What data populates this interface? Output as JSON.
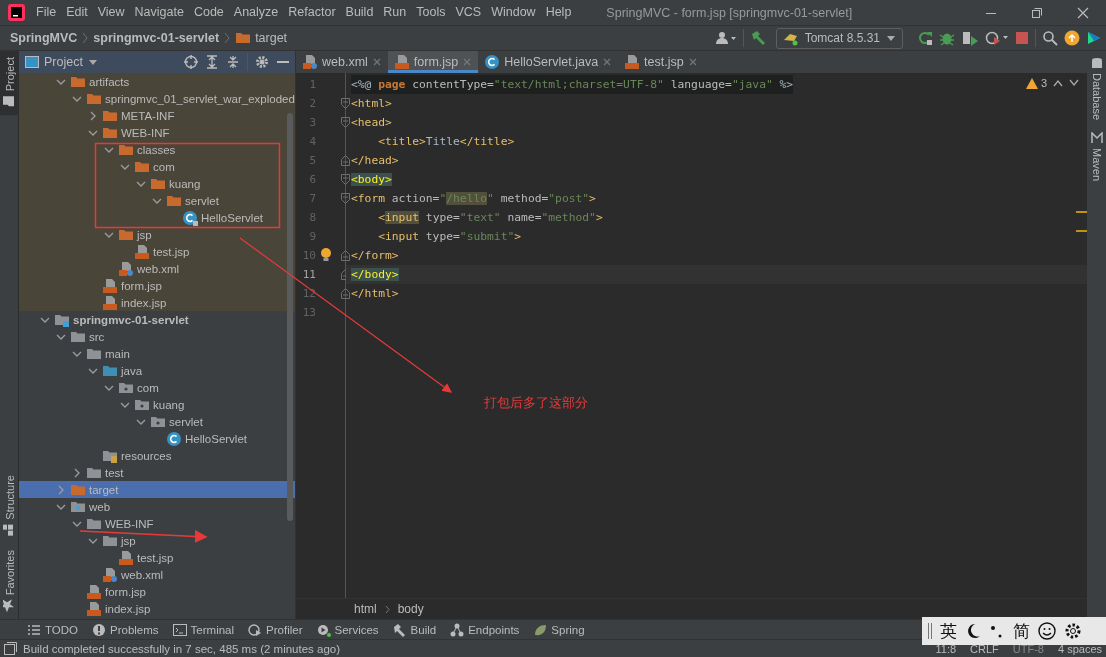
{
  "window": {
    "title": "SpringMVC - form.jsp [springmvc-01-servlet]"
  },
  "menu": [
    "File",
    "Edit",
    "View",
    "Navigate",
    "Code",
    "Analyze",
    "Refactor",
    "Build",
    "Run",
    "Tools",
    "VCS",
    "Window",
    "Help"
  ],
  "breadcrumbs": [
    {
      "label": "SpringMVC",
      "kind": "project"
    },
    {
      "label": "springmvc-01-servlet",
      "kind": "module"
    },
    {
      "label": "target",
      "kind": "folder"
    }
  ],
  "run_config": {
    "label": "Tomcat 8.5.31"
  },
  "left_stripe": [
    {
      "label": "Project",
      "selected": true
    },
    {
      "label": "Structure",
      "selected": false
    },
    {
      "label": "Favorites",
      "selected": false
    }
  ],
  "right_stripe": [
    "Database",
    "Maven"
  ],
  "project_panel": {
    "title": "Project",
    "output_tree": [
      {
        "label": "artifacts",
        "kind": "excluded-folder",
        "expanded": true,
        "selected": false,
        "children": [
          {
            "label": "springmvc_01_servlet_war_exploded",
            "kind": "excluded-folder",
            "expanded": true,
            "selected": false,
            "children": [
              {
                "label": "META-INF",
                "kind": "excluded-folder",
                "expanded": false,
                "selected": false
              },
              {
                "label": "WEB-INF",
                "kind": "excluded-folder",
                "expanded": true,
                "selected": false,
                "children": [
                  {
                    "label": "classes",
                    "kind": "excluded-folder",
                    "expanded": true,
                    "selected": false,
                    "children": [
                      {
                        "label": "com",
                        "kind": "excluded-folder",
                        "expanded": true,
                        "selected": false,
                        "children": [
                          {
                            "label": "kuang",
                            "kind": "excluded-folder",
                            "expanded": true,
                            "selected": false,
                            "children": [
                              {
                                "label": "servlet",
                                "kind": "excluded-folder",
                                "expanded": true,
                                "selected": false,
                                "children": [
                                  {
                                    "label": "HelloServlet",
                                    "kind": "compiled-class",
                                    "selected": false
                                  }
                                ]
                              }
                            ]
                          }
                        ]
                      }
                    ]
                  },
                  {
                    "label": "jsp",
                    "kind": "excluded-folder",
                    "expanded": true,
                    "selected": false,
                    "children": [
                      {
                        "label": "test.jsp",
                        "kind": "jsp",
                        "selected": false
                      }
                    ]
                  },
                  {
                    "label": "web.xml",
                    "kind": "xml",
                    "selected": false
                  }
                ]
              },
              {
                "label": "form.jsp",
                "kind": "jsp",
                "selected": false
              },
              {
                "label": "index.jsp",
                "kind": "jsp",
                "selected": false
              }
            ]
          }
        ]
      }
    ],
    "tree": [
      {
        "label": "springmvc-01-servlet",
        "kind": "module",
        "expanded": true,
        "selected": false,
        "children": [
          {
            "label": "src",
            "kind": "folder",
            "expanded": true,
            "selected": false,
            "children": [
              {
                "label": "main",
                "kind": "folder",
                "expanded": true,
                "selected": false,
                "children": [
                  {
                    "label": "java",
                    "kind": "source-folder",
                    "expanded": true,
                    "selected": false,
                    "children": [
                      {
                        "label": "com",
                        "kind": "package",
                        "expanded": true,
                        "selected": false,
                        "children": [
                          {
                            "label": "kuang",
                            "kind": "package",
                            "expanded": true,
                            "selected": false,
                            "children": [
                              {
                                "label": "servlet",
                                "kind": "package",
                                "expanded": true,
                                "selected": false,
                                "children": [
                                  {
                                    "label": "HelloServlet",
                                    "kind": "class",
                                    "selected": false
                                  }
                                ]
                              }
                            ]
                          }
                        ]
                      }
                    ]
                  },
                  {
                    "label": "resources",
                    "kind": "resources-folder",
                    "selected": false
                  }
                ]
              },
              {
                "label": "test",
                "kind": "folder",
                "expanded": false,
                "selected": false
              }
            ]
          },
          {
            "label": "target",
            "kind": "excluded-folder",
            "expanded": false,
            "selected": true
          },
          {
            "label": "web",
            "kind": "web-folder",
            "expanded": true,
            "selected": false,
            "children": [
              {
                "label": "WEB-INF",
                "kind": "folder",
                "expanded": true,
                "selected": false,
                "children": [
                  {
                    "label": "jsp",
                    "kind": "folder",
                    "expanded": true,
                    "selected": false,
                    "children": [
                      {
                        "label": "test.jsp",
                        "kind": "jsp",
                        "selected": false
                      }
                    ]
                  },
                  {
                    "label": "web.xml",
                    "kind": "xml",
                    "selected": false
                  }
                ]
              },
              {
                "label": "form.jsp",
                "kind": "jsp",
                "selected": false
              },
              {
                "label": "index.jsp",
                "kind": "jsp",
                "selected": false
              }
            ]
          }
        ]
      }
    ]
  },
  "editor": {
    "tabs": [
      {
        "label": "web.xml",
        "kind": "xml",
        "selected": false
      },
      {
        "label": "form.jsp",
        "kind": "jsp",
        "selected": true
      },
      {
        "label": "HelloServlet.java",
        "kind": "class",
        "selected": false
      },
      {
        "label": "test.jsp",
        "kind": "jsp",
        "selected": false
      }
    ],
    "warnings": "3",
    "lines": [
      {
        "number": "1",
        "current": false,
        "fold_start": false,
        "fold_end": false,
        "injected": true,
        "tokens": [
          {
            "text": "<%@ ",
            "kind": "plain"
          },
          {
            "text": "page",
            "kind": "keyword"
          },
          {
            "text": " contentType=",
            "kind": "attr"
          },
          {
            "text": "\"text/html;charset=UTF-8\"",
            "kind": "value"
          },
          {
            "text": " language=",
            "kind": "attr"
          },
          {
            "text": "\"java\"",
            "kind": "value"
          },
          {
            "text": " %>",
            "kind": "plain"
          }
        ]
      },
      {
        "number": "2",
        "current": false,
        "fold_start": true,
        "tokens": [
          {
            "text": "<html>",
            "kind": "tag"
          }
        ]
      },
      {
        "number": "3",
        "current": false,
        "fold_start": true,
        "tokens": [
          {
            "text": "<head>",
            "kind": "tag"
          }
        ]
      },
      {
        "number": "4",
        "current": false,
        "fold_start": false,
        "fold_end": false,
        "tokens": [
          {
            "text": "    <title>",
            "kind": "tag"
          },
          {
            "text": "Title",
            "kind": "plain"
          },
          {
            "text": "</title>",
            "kind": "tag"
          }
        ]
      },
      {
        "number": "5",
        "current": false,
        "fold_start": false,
        "fold_end": true,
        "tokens": [
          {
            "text": "</head>",
            "kind": "tag"
          }
        ]
      },
      {
        "number": "6",
        "current": false,
        "fold_start": true,
        "tokens": [
          {
            "text": "<body>",
            "kind": "tag",
            "matched": true
          }
        ]
      },
      {
        "number": "7",
        "current": false,
        "fold_start": true,
        "tokens": [
          {
            "text": "<form",
            "kind": "tag"
          },
          {
            "text": " action=",
            "kind": "attr"
          },
          {
            "text": "\"",
            "kind": "value"
          },
          {
            "text": "/hello",
            "kind": "value",
            "usage": true
          },
          {
            "text": "\"",
            "kind": "value"
          },
          {
            "text": " method=",
            "kind": "attr"
          },
          {
            "text": "\"post\"",
            "kind": "value"
          },
          {
            "text": ">",
            "kind": "tag"
          }
        ]
      },
      {
        "number": "8",
        "current": false,
        "fold_start": false,
        "fold_end": false,
        "tokens": [
          {
            "text": "    <",
            "kind": "tag"
          },
          {
            "text": "input",
            "kind": "tag",
            "usage": true
          },
          {
            "text": " type=",
            "kind": "attr"
          },
          {
            "text": "\"text\"",
            "kind": "value"
          },
          {
            "text": " name=",
            "kind": "attr"
          },
          {
            "text": "\"method\"",
            "kind": "value"
          },
          {
            "text": ">",
            "kind": "tag"
          }
        ]
      },
      {
        "number": "9",
        "current": false,
        "fold_start": false,
        "fold_end": false,
        "tokens": [
          {
            "text": "    <input",
            "kind": "tag"
          },
          {
            "text": " type=",
            "kind": "attr"
          },
          {
            "text": "\"submit\"",
            "kind": "value"
          },
          {
            "text": ">",
            "kind": "tag"
          }
        ]
      },
      {
        "number": "10",
        "current": false,
        "fold_start": false,
        "fold_end": true,
        "tokens": [
          {
            "text": "</form>",
            "kind": "tag"
          }
        ]
      },
      {
        "number": "11",
        "current": true,
        "fold_start": false,
        "fold_end": true,
        "tokens": [
          {
            "text": "</body>",
            "kind": "tag",
            "matched": true
          }
        ]
      },
      {
        "number": "12",
        "current": false,
        "fold_start": false,
        "fold_end": true,
        "tokens": [
          {
            "text": "</html>",
            "kind": "tag"
          }
        ]
      },
      {
        "number": "13",
        "current": false,
        "fold_start": false,
        "fold_end": false
      }
    ],
    "breadcrumbs": [
      "html",
      "body"
    ]
  },
  "tool_windows": [
    {
      "label": "TODO",
      "kind": "todo"
    },
    {
      "label": "Problems",
      "kind": "problems"
    },
    {
      "label": "Terminal",
      "kind": "terminal"
    },
    {
      "label": "Profiler",
      "kind": "profiler"
    },
    {
      "label": "Services",
      "kind": "services"
    },
    {
      "label": "Build",
      "kind": "build"
    },
    {
      "label": "Endpoints",
      "kind": "endpoints"
    },
    {
      "label": "Spring",
      "kind": "spring"
    }
  ],
  "status_bar": {
    "message": "Build completed successfully in 7 sec, 485 ms (2 minutes ago)",
    "position": "11:8",
    "line_separator": "CRLF",
    "encoding": "UTF-8",
    "indent": "4 spaces"
  },
  "ime_bar": {
    "language": "英",
    "mode": "简"
  },
  "annotation": {
    "note": "打包后多了这部分"
  }
}
